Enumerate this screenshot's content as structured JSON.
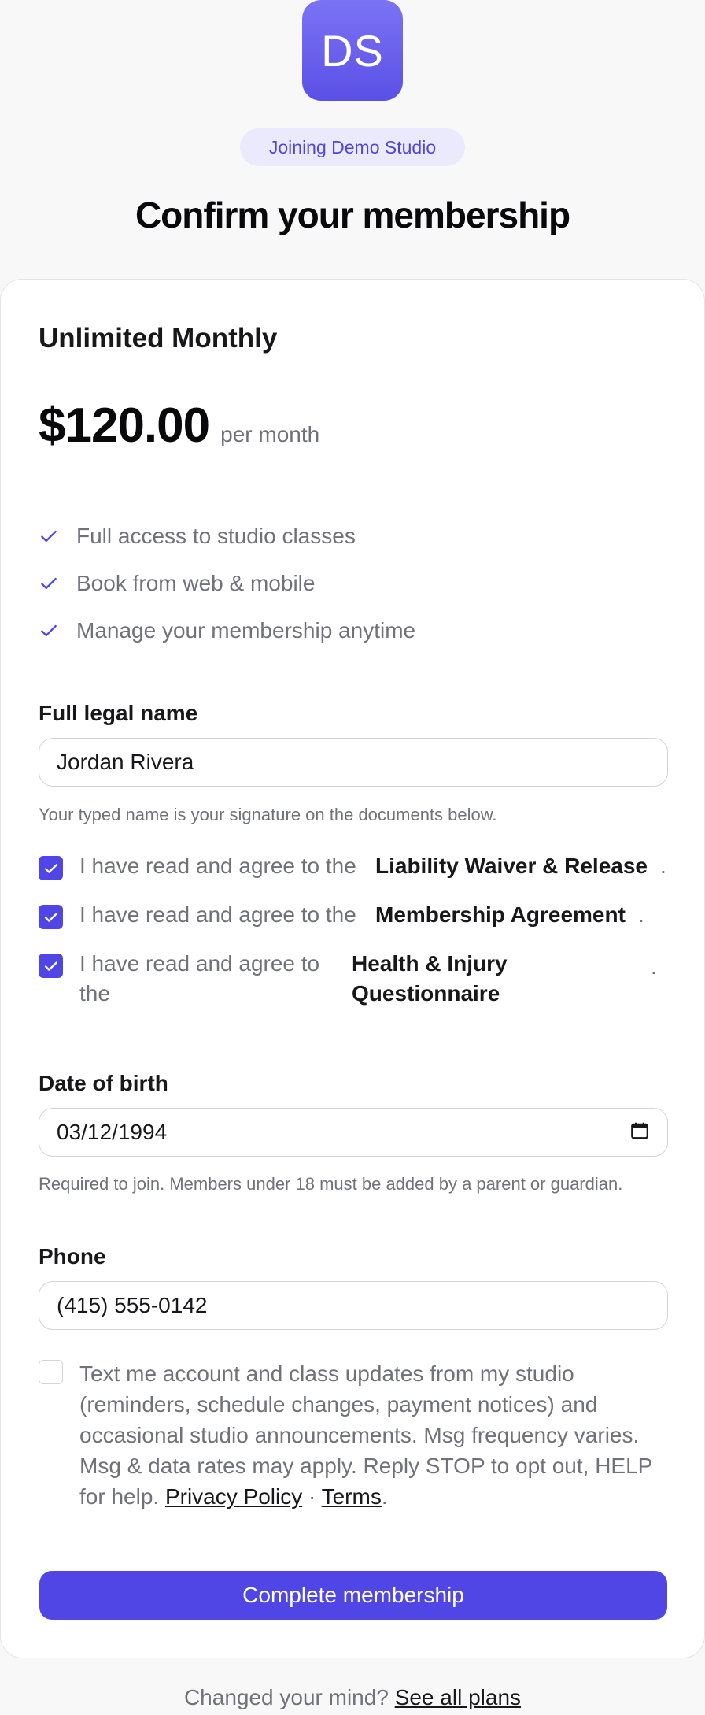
{
  "header": {
    "logo_initials": "DS",
    "joining_badge": "Joining Demo Studio",
    "title": "Confirm your membership"
  },
  "plan": {
    "name": "Unlimited Monthly",
    "price": "$120.00",
    "period": "per month",
    "features": [
      "Full access to studio classes",
      "Book from web & mobile",
      "Manage your membership anytime"
    ]
  },
  "form": {
    "full_name": {
      "label": "Full legal name",
      "value": "Jordan Rivera",
      "help": "Your typed name is your signature on the documents below."
    },
    "agreements": [
      {
        "prefix": "I have read and agree to the",
        "document": "Liability Waiver & Release",
        "suffix": ".",
        "checked": true
      },
      {
        "prefix": "I have read and agree to the",
        "document": "Membership Agreement",
        "suffix": ".",
        "checked": true
      },
      {
        "prefix": "I have read and agree to the",
        "document": "Health & Injury Questionnaire",
        "suffix": ".",
        "checked": true
      }
    ],
    "dob": {
      "label": "Date of birth",
      "value": "03/12/1994",
      "help": "Required to join. Members under 18 must be added by a parent or guardian."
    },
    "phone": {
      "label": "Phone",
      "value": "(415) 555-0142"
    },
    "sms_consent": {
      "checked": false,
      "text": "Text me account and class updates from my studio (reminders, schedule changes, payment notices) and occasional studio announcements. Msg frequency varies. Msg & data rates may apply. Reply STOP to opt out, HELP for help.",
      "privacy_link": "Privacy Policy",
      "separator": "·",
      "terms_link": "Terms",
      "end": "."
    },
    "submit_label": "Complete membership"
  },
  "footer": {
    "prompt": "Changed your mind?",
    "link": "See all plans"
  },
  "colors": {
    "accent": "#5046e5",
    "badge_bg": "#ebe9fc",
    "muted_text": "#71717a"
  },
  "icons": [
    "check-icon",
    "checkbox-checked-icon",
    "calendar-icon"
  ]
}
